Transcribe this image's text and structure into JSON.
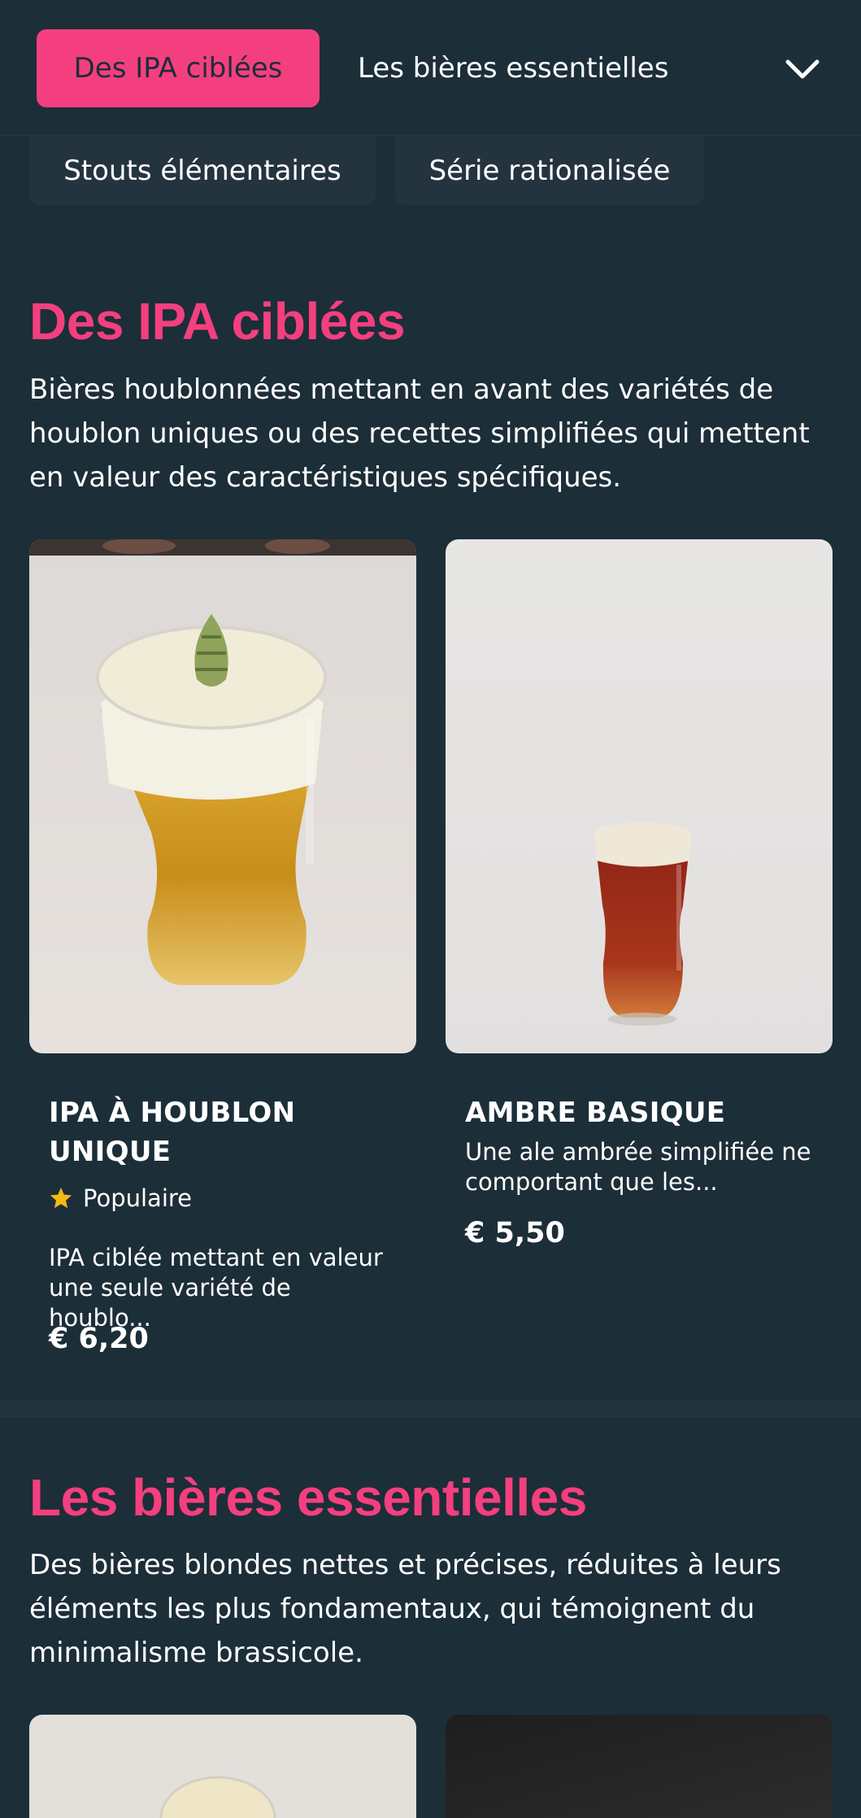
{
  "nav": {
    "active_tab": "Des IPA ciblées",
    "tab2": "Les bières essentielles",
    "chip1": "Stouts élémentaires",
    "chip2": "Série rationalisée"
  },
  "section1": {
    "title": "Des IPA ciblées",
    "description": "Bières houblonnées mettant en avant des variétés de houblon uniques ou des recettes simplifiées qui mettent en valeur des caractéristiques spécifiques.",
    "products": [
      {
        "name": "IPA À HOUBLON UNIQUE",
        "badge": "Populaire",
        "description": "IPA ciblée mettant en valeur une seule variété de houblo...",
        "price": "€ 6,20"
      },
      {
        "name": "AMBRE BASIQUE",
        "description": "Une ale ambrée simplifiée ne comportant que les...",
        "price": "€ 5,50"
      }
    ]
  },
  "section2": {
    "title": "Les bières essentielles",
    "description": "Des bières blondes nettes et précises, réduites à leurs éléments les plus fondamentaux, qui témoignent du minimalisme brassicole."
  },
  "colors": {
    "background": "#1c2e38",
    "accent": "#f43f7f",
    "chip": "#24343f",
    "star": "#f5b916"
  }
}
